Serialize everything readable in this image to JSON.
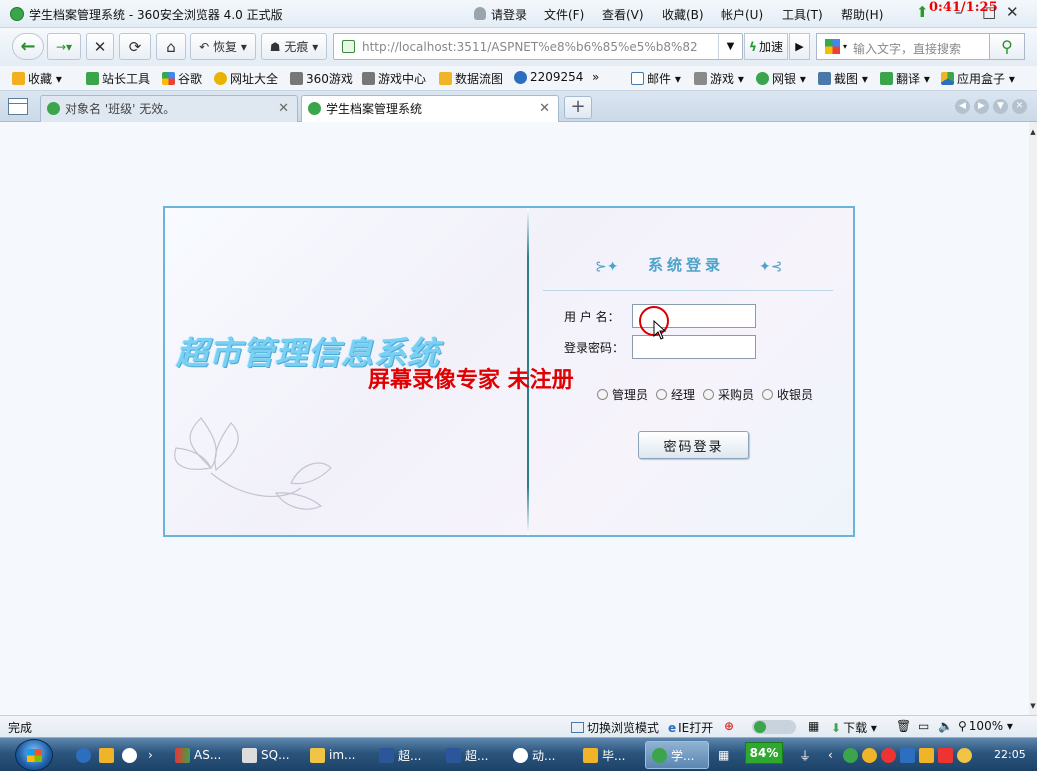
{
  "browser": {
    "title": "学生档案管理系统 - 360安全浏览器 4.0 正式版",
    "login_label": "请登录",
    "menu": [
      "文件(F)",
      "查看(V)",
      "收藏(B)",
      "帐户(U)",
      "工具(T)",
      "帮助(H)"
    ],
    "recorder_timer": "0:41/1:25",
    "toolbar": {
      "restore_label": "恢复",
      "incognito_label": "无痕",
      "url": "http://localhost:3511/ASPNET%e8%b6%85%e5%b8%82",
      "accelerate_label": "加速",
      "search_placeholder": "输入文字，直接搜索"
    },
    "favorites": [
      "收藏",
      "站长工具",
      "谷歌",
      "网址大全",
      "360游戏",
      "游戏中心",
      "数据流图",
      "2209254",
      "»",
      "邮件",
      "游戏",
      "网银",
      "截图",
      "翻译",
      "应用盒子"
    ],
    "tabs": [
      {
        "label": "对象名 '班级' 无效。",
        "active": false
      },
      {
        "label": "学生档案管理系统",
        "active": true
      }
    ],
    "status": {
      "left": "完成",
      "switch_mode": "切换浏览模式",
      "ie_open": "IE打开",
      "download": "下载",
      "zoom": "100%"
    }
  },
  "page": {
    "system_name": "超市管理信息系统",
    "watermark": "屏幕录像专家  未注册",
    "login_title": "系统登录",
    "username_label": "用 户 名：",
    "password_label": "登录密码：",
    "username_value": "",
    "password_value": "",
    "roles": [
      "管理员",
      "经理",
      "采购员",
      "收银员"
    ],
    "login_button": "密码登录"
  },
  "taskbar": {
    "items": [
      "AS...",
      "SQ...",
      "im...",
      "超...",
      "超...",
      "动...",
      "毕...",
      "学..."
    ],
    "cpu": "84%",
    "clock": "22:05"
  },
  "colors": {
    "panel_border": "#6ab3d9",
    "title_blue": "#4fa3c9",
    "watermark_red": "#e00000",
    "system_name_blue": "#7ad0f2"
  }
}
